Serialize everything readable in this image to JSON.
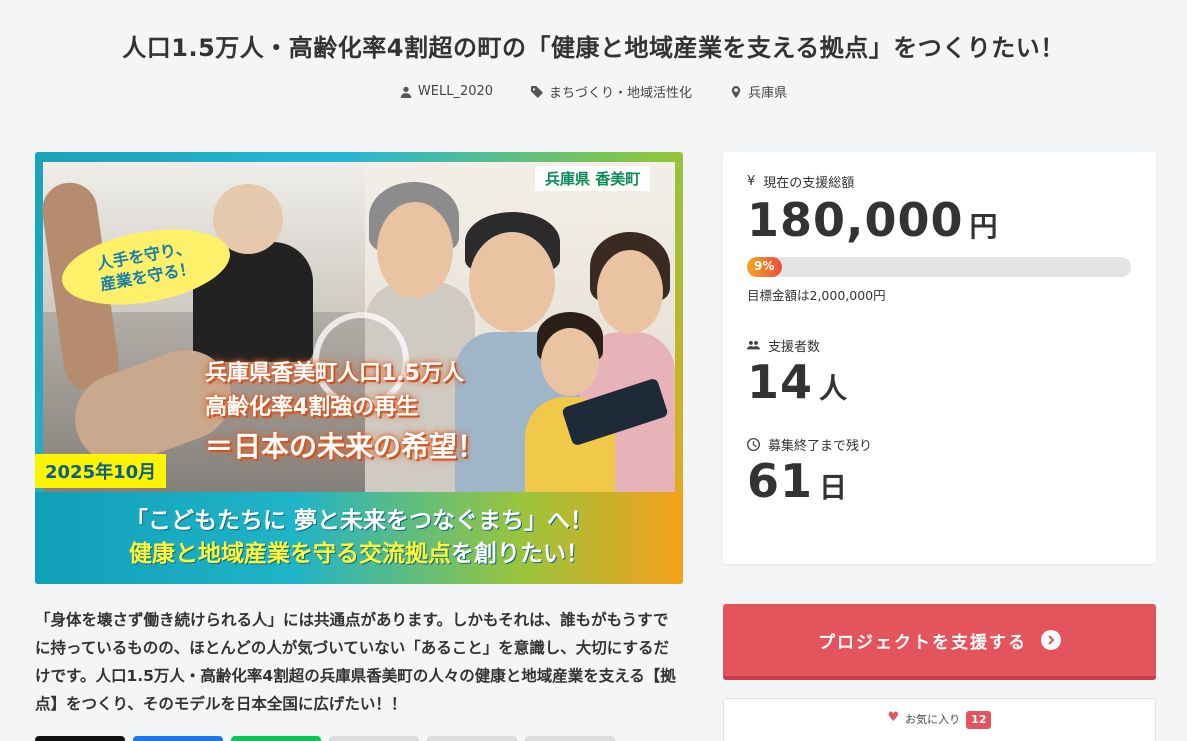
{
  "project": {
    "title": "人口1.5万人・高齢化率4割超の町の「健康と地域産業を支える拠点」をつくりたい！",
    "owner": "WELL_2020",
    "category": "まちづくり・地域活性化",
    "location": "兵庫県"
  },
  "hero": {
    "prefecture_tag": "兵庫県 香美町",
    "bubble_line1": "人手を守り、",
    "bubble_line2": "産業を守る！",
    "headline_line1": "兵庫県香美町人口1.5万人",
    "headline_line2": "高齢化率4割強の再生",
    "headline_line3": "＝日本の未来の希望！",
    "date_badge": "2025年10月",
    "bottom_line1": "「こどもたちに 夢と未来をつなぐまち」へ！",
    "bottom_line2a": "健康と地域産業を守る交流拠点",
    "bottom_line2b": "を創りたい！"
  },
  "description": "「身体を壊さず働き続けられる人」には共通点があります。しかもそれは、誰もがもうすでに持っているものの、ほとんどの人が気づいていない「あること」を意識し、大切にするだけです。人口1.5万人・高齢化率4割超の兵庫県香美町の人々の健康と地域産業を支える【拠点】をつくり、そのモデルを日本全国に広げたい！！",
  "stats": {
    "amount_label": "現在の支援総額",
    "amount": "180,000",
    "amount_unit": "円",
    "progress_percent": 9,
    "progress_label": "9%",
    "target_text": "目標金額は2,000,000円",
    "supporters_label": "支援者数",
    "supporters": "14",
    "supporters_unit": "人",
    "remaining_label": "募集終了まで残り",
    "remaining": "61",
    "remaining_unit": "日"
  },
  "actions": {
    "support_label": "プロジェクトを支援する",
    "favorite_label": "お気に入り",
    "favorite_count": "12"
  },
  "colors": {
    "accent": "#e4545c",
    "progress_start": "#f5a623",
    "progress_end": "#e94e3c"
  }
}
